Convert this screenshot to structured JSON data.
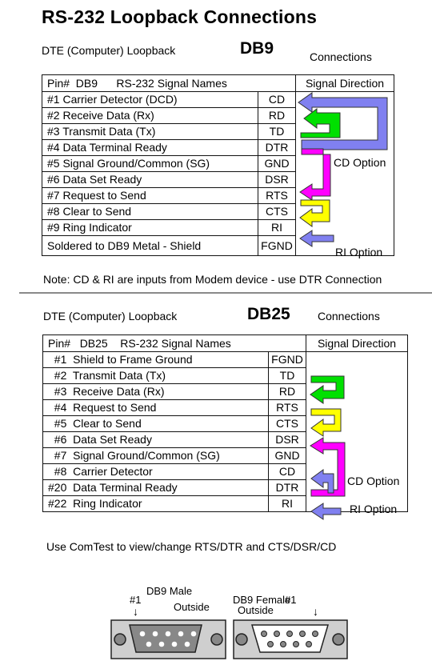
{
  "title": "RS-232  Loopback Connections",
  "db9": {
    "subtitle": "DTE (Computer) Loopback",
    "connector": "DB9",
    "connections_label": "Connections",
    "header": {
      "pin": "Pin#  DB9      RS-232 Signal Names",
      "direction": "Signal Direction"
    },
    "rows": [
      {
        "name": "#1  Carrier Detector (DCD)",
        "signal": "CD"
      },
      {
        "name": "#2  Receive Data (Rx)",
        "signal": "RD"
      },
      {
        "name": "#3  Transmit Data (Tx)",
        "signal": "TD"
      },
      {
        "name": "#4  Data Terminal Ready",
        "signal": "DTR"
      },
      {
        "name": "#5  Signal Ground/Common (SG)",
        "signal": "GND"
      },
      {
        "name": "#6  Data Set Ready",
        "signal": "DSR"
      },
      {
        "name": "#7  Request to Send",
        "signal": "RTS"
      },
      {
        "name": "#8  Clear to Send",
        "signal": "CTS"
      },
      {
        "name": "#9  Ring Indicator",
        "signal": "RI"
      },
      {
        "name": "Soldered to DB9 Metal - Shield",
        "signal": "FGND"
      }
    ],
    "cd_option": "CD Option",
    "ri_option": "RI Option",
    "note": "Note:  CD & RI are inputs from Modem device - use DTR Connection"
  },
  "db25": {
    "subtitle": "DTE (Computer) Loopback",
    "connector": "DB25",
    "connections_label": "Connections",
    "header": {
      "pin": "Pin#   DB25    RS-232 Signal Names",
      "direction": "Signal Direction"
    },
    "rows": [
      {
        "name": "  #1  Shield to Frame Ground",
        "signal": "FGND"
      },
      {
        "name": "  #2  Transmit Data (Tx)",
        "signal": "TD"
      },
      {
        "name": "  #3  Receive Data (Rx)",
        "signal": "RD"
      },
      {
        "name": "  #4  Request to Send",
        "signal": "RTS"
      },
      {
        "name": "  #5  Clear to Send",
        "signal": "CTS"
      },
      {
        "name": "  #6  Data Set Ready",
        "signal": "DSR"
      },
      {
        "name": "  #7  Signal Ground/Common (SG)",
        "signal": "GND"
      },
      {
        "name": "  #8  Carrier Detector",
        "signal": "CD"
      },
      {
        "name": "#20  Data Terminal Ready",
        "signal": "DTR"
      },
      {
        "name": "#22  Ring Indicator",
        "signal": "RI"
      }
    ],
    "cd_option": "CD Option",
    "ri_option": "RI Option"
  },
  "comtest_note": "Use ComTest to view/change RTS/DTR and CTS/DSR/CD",
  "connectors": {
    "male": {
      "pin1": "#1",
      "label": "DB9 Male",
      "side": "Outside",
      "arrow": "↓"
    },
    "female": {
      "pin1": "#1",
      "label": "DB9 Female",
      "side": "Outside",
      "arrow": "↓"
    }
  },
  "colors": {
    "cd": "#8080f0",
    "data": "#00e000",
    "dsr": "#ff00ff",
    "rts": "#ffff00",
    "ri": "#8080f0"
  }
}
